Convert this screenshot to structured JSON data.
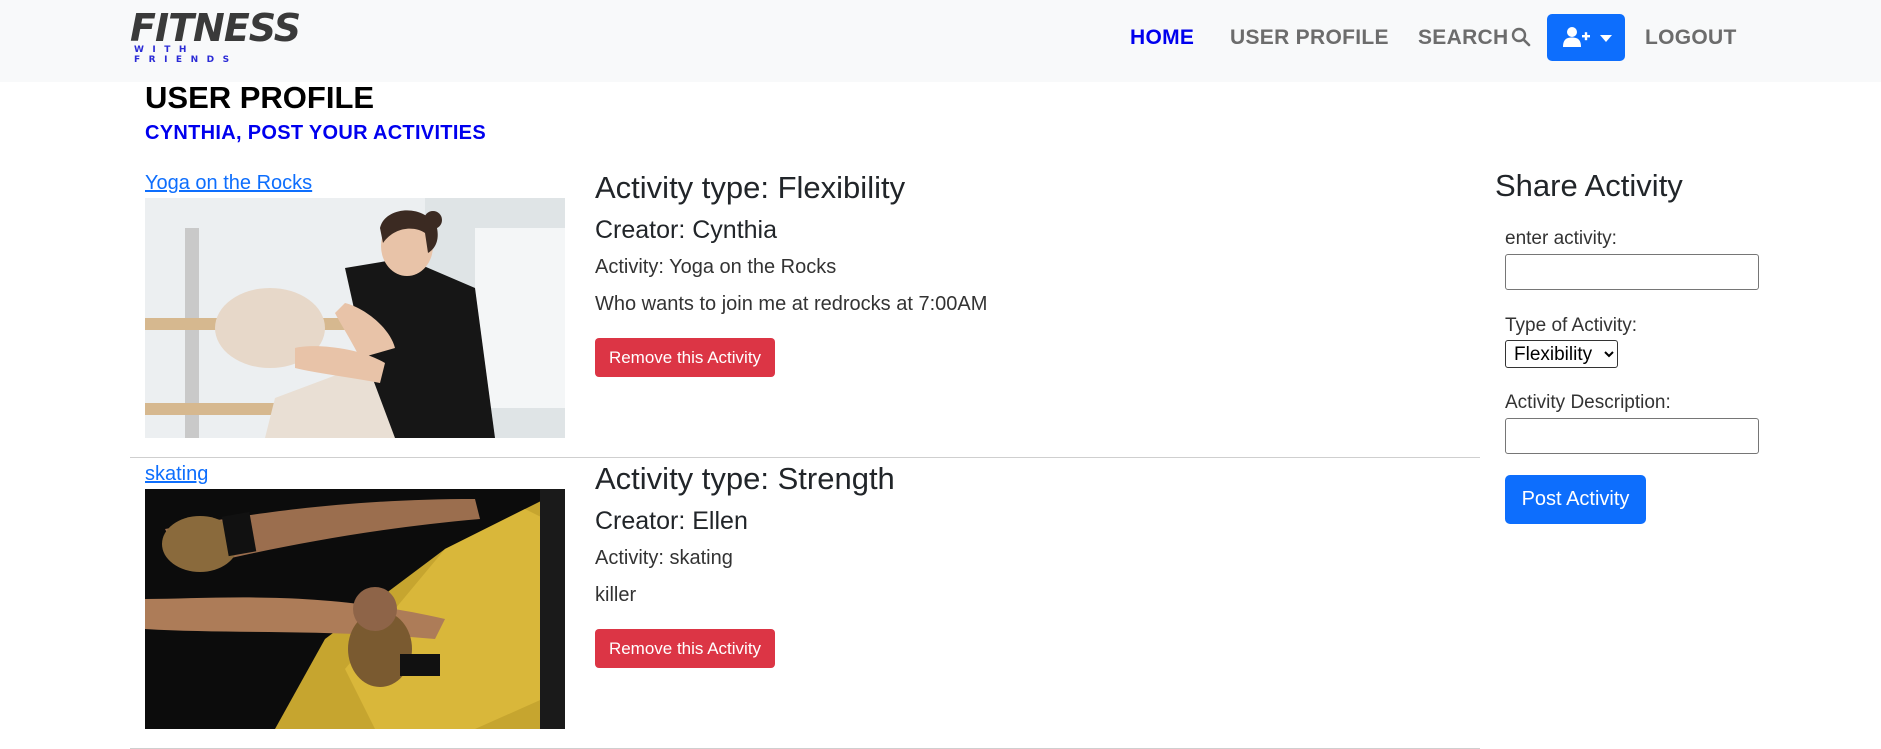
{
  "brand": {
    "name": "FITNESS",
    "tagline": "WITH FRIENDS"
  },
  "nav": {
    "home": "HOME",
    "user_profile": "USER PROFILE",
    "search": "SEARCH",
    "logout": "LOGOUT",
    "search_icon": "search-icon",
    "user_menu_icon": "user-plus-icon"
  },
  "page": {
    "title": "USER PROFILE",
    "subtitle": "CYNTHIA, POST YOUR ACTIVITIES"
  },
  "activities": [
    {
      "link": "Yoga on the Rocks",
      "type": "Activity type: Flexibility",
      "creator": "Creator: Cynthia",
      "activity": "Activity: Yoga on the Rocks",
      "description": "Who wants to join me at redrocks at 7:00AM",
      "remove_label": "Remove this Activity",
      "image": "woman-stretching-at-ballet-barre"
    },
    {
      "link": "skating",
      "type": "Activity type: Strength",
      "creator": "Creator: Ellen",
      "activity": "Activity: skating",
      "description": "killer",
      "remove_label": "Remove this Activity",
      "image": "boxer-with-gloves"
    }
  ],
  "share_form": {
    "title": "Share Activity",
    "activity_label": "enter activity:",
    "activity_value": "",
    "type_label": "Type of Activity:",
    "type_selected": "Flexibility",
    "description_label": "Activity Description:",
    "description_value": "",
    "submit_label": "Post Activity"
  },
  "colors": {
    "navbar_bg": "#f8f9fa",
    "active_link": "#0000ee",
    "primary": "#0d6efd",
    "danger": "#dc3545"
  }
}
